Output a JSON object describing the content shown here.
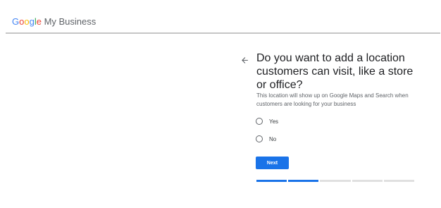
{
  "header": {
    "logo_letters": [
      "G",
      "o",
      "o",
      "g",
      "l",
      "e"
    ],
    "logo_rest": " My Business"
  },
  "question": {
    "title": "Do you want to add a location customers can visit, like a store or office?",
    "subtitle": "This location will show up on Google Maps and Search when customers are looking for your business"
  },
  "options": [
    {
      "label": "Yes",
      "selected": false
    },
    {
      "label": "No",
      "selected": false
    }
  ],
  "actions": {
    "next_label": "Next"
  },
  "progress": {
    "total_steps": 5,
    "completed_steps": 2
  },
  "colors": {
    "accent": "#1a73e8",
    "google_blue": "#4285F4",
    "google_red": "#EA4335",
    "google_yellow": "#FBBC05",
    "google_green": "#34A853"
  },
  "icons": {
    "back": "arrow-left-icon"
  }
}
